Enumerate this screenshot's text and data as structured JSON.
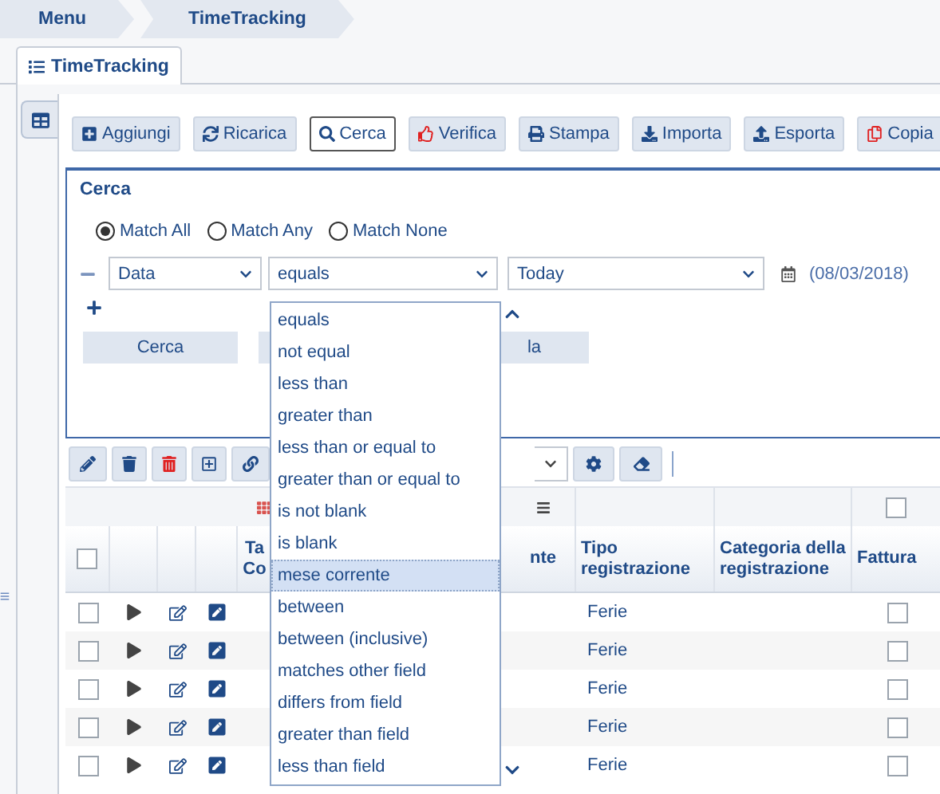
{
  "breadcrumbs": [
    {
      "label": "Menu"
    },
    {
      "label": "TimeTracking"
    }
  ],
  "tab": {
    "label": "TimeTracking",
    "selected": true
  },
  "toolbar": [
    {
      "label": "Aggiungi",
      "kind": "add",
      "selected": false
    },
    {
      "label": "Ricarica",
      "kind": "reload",
      "selected": false
    },
    {
      "label": "Cerca",
      "kind": "search",
      "selected": true
    },
    {
      "label": "Verifica",
      "kind": "verify",
      "selected": false
    },
    {
      "label": "Stampa",
      "kind": "print",
      "selected": false
    },
    {
      "label": "Importa",
      "kind": "import",
      "selected": false
    },
    {
      "label": "Esporta",
      "kind": "export",
      "selected": false
    },
    {
      "label": "Copia",
      "kind": "copy",
      "selected": false
    }
  ],
  "search_panel": {
    "title": "Cerca",
    "match_modes": [
      {
        "label": "Match All",
        "selected": true
      },
      {
        "label": "Match Any",
        "selected": false
      },
      {
        "label": "Match None",
        "selected": false
      }
    ],
    "filter": {
      "field": "Data",
      "operator": "equals",
      "value": "Today",
      "date": "(08/03/2018)"
    },
    "buttons": [
      {
        "label": "Cerca"
      },
      {
        "label": "la"
      }
    ]
  },
  "operator_dropdown": {
    "options": [
      {
        "label": "equals",
        "selected": false
      },
      {
        "label": "not equal",
        "selected": false
      },
      {
        "label": "less than",
        "selected": false
      },
      {
        "label": "greater than",
        "selected": false
      },
      {
        "label": "less than or equal to",
        "selected": false
      },
      {
        "label": "greater than or equal to",
        "selected": false
      },
      {
        "label": "is not blank",
        "selected": false
      },
      {
        "label": "is blank",
        "selected": false
      },
      {
        "label": "mese corrente",
        "selected": true
      },
      {
        "label": "between",
        "selected": false
      },
      {
        "label": "between (inclusive)",
        "selected": false
      },
      {
        "label": "matches other field",
        "selected": false
      },
      {
        "label": "differs from field",
        "selected": false
      },
      {
        "label": "greater than field",
        "selected": false
      },
      {
        "label": "less than field",
        "selected": false
      }
    ]
  },
  "table": {
    "header_checked": false,
    "fatturabile_all_checked": false,
    "columns": [
      {
        "label": "Ta Co"
      },
      {
        "label": "nte"
      },
      {
        "label": "Tipo registrazione"
      },
      {
        "label": "Categoria della registrazione"
      },
      {
        "label": "Fattura"
      }
    ],
    "rows": [
      {
        "checked": false,
        "tipo": "Ferie",
        "fatturabile": false
      },
      {
        "checked": false,
        "tipo": "Ferie",
        "fatturabile": false
      },
      {
        "checked": false,
        "tipo": "Ferie",
        "fatturabile": false
      },
      {
        "checked": false,
        "tipo": "Ferie",
        "fatturabile": false
      },
      {
        "checked": false,
        "tipo": "Ferie",
        "fatturabile": false
      }
    ]
  }
}
